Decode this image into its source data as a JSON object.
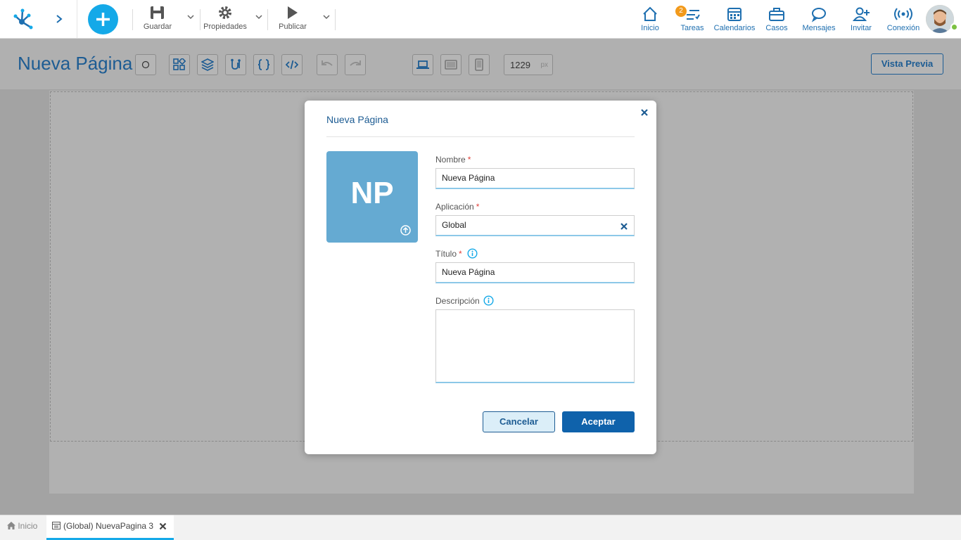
{
  "topbar": {
    "toolbar": {
      "save_label": "Guardar",
      "properties_label": "Propiedades",
      "publish_label": "Publicar"
    },
    "nav": [
      {
        "label": "Inicio",
        "icon": "home-icon"
      },
      {
        "label": "Tareas",
        "icon": "tasks-icon",
        "badge": "2"
      },
      {
        "label": "Calendarios",
        "icon": "calendar-icon"
      },
      {
        "label": "Casos",
        "icon": "briefcase-icon"
      },
      {
        "label": "Mensajes",
        "icon": "chat-icon"
      },
      {
        "label": "Invitar",
        "icon": "invite-user-icon"
      },
      {
        "label": "Conexión",
        "icon": "connection-icon"
      }
    ],
    "colors": {
      "accent": "#14a9e8",
      "primary": "#1d5c93",
      "badge": "#f29a1c"
    }
  },
  "editor": {
    "page_name": "Nueva Página",
    "width_value": "1229",
    "width_unit": "px",
    "preview_label": "Vista Previa"
  },
  "modal": {
    "title": "Nueva Página",
    "initials": "NP",
    "fields": {
      "name_label": "Nombre",
      "name_value": "Nueva Página",
      "app_label": "Aplicación",
      "app_value": "Global",
      "title_label": "Título",
      "title_value": "Nueva Página",
      "description_label": "Descripción",
      "required_mark": "*"
    },
    "cancel_label": "Cancelar",
    "accept_label": "Aceptar"
  },
  "bottom": {
    "home_tab": "Inicio",
    "page_tab": "(Global) NuevaPagina 3"
  }
}
